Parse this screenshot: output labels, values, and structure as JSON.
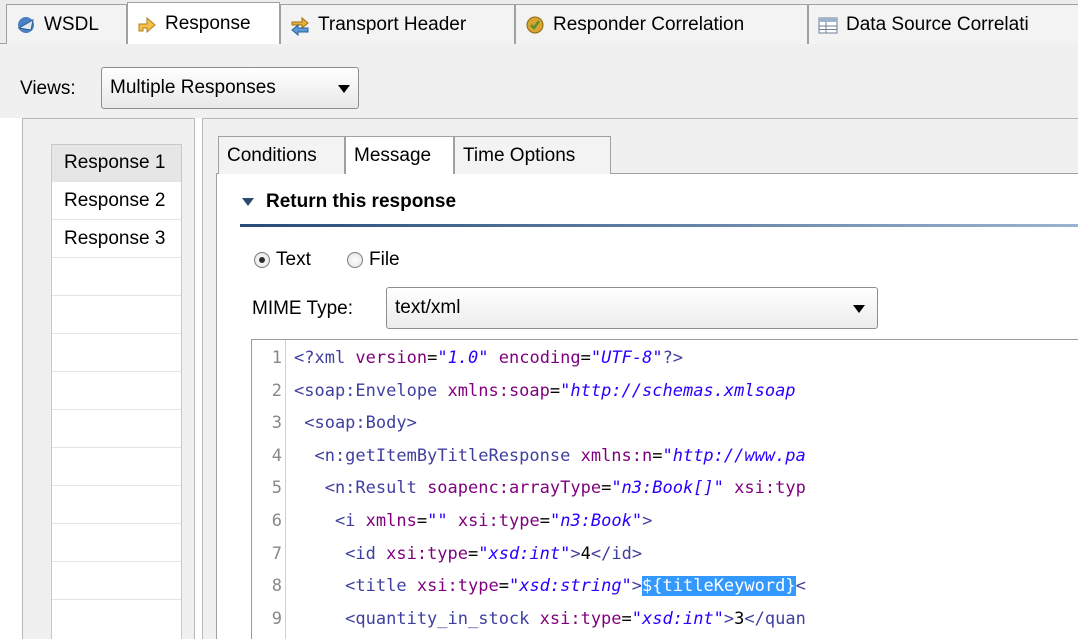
{
  "top_tabs": [
    {
      "label": "WSDL",
      "icon": "wsdl-icon",
      "active": false
    },
    {
      "label": "Response",
      "icon": "response-arrow-icon",
      "active": true
    },
    {
      "label": "Transport Header",
      "icon": "transport-header-icon",
      "active": false
    },
    {
      "label": "Responder Correlation",
      "icon": "responder-correlation-icon",
      "active": false
    },
    {
      "label": "Data Source Correlati",
      "icon": "data-source-table-icon",
      "active": false
    }
  ],
  "views": {
    "label": "Views:",
    "selected": "Multiple Responses"
  },
  "responses": [
    "Response 1",
    "Response 2",
    "Response 3"
  ],
  "inner_tabs": [
    "Conditions",
    "Message",
    "Time Options"
  ],
  "section": {
    "title": "Return this response"
  },
  "radio": {
    "text_label": "Text",
    "file_label": "File",
    "selected": "Text"
  },
  "mime": {
    "label": "MIME Type:",
    "selected": "text/xml"
  },
  "colors": {
    "tag": "#3f3f9f",
    "attr": "#7f007f",
    "value": "#2a00ff",
    "highlight": "#3399ff",
    "section_rule": "#274b78"
  },
  "editor": {
    "lines": [
      {
        "n": "1",
        "parts": [
          [
            "tag",
            "<?xml "
          ],
          [
            "attr",
            "version"
          ],
          [
            "txt",
            "="
          ],
          [
            "val",
            "\"1.0\""
          ],
          [
            "txt",
            " "
          ],
          [
            "attr",
            "encoding"
          ],
          [
            "txt",
            "="
          ],
          [
            "val",
            "\"UTF-8\""
          ],
          [
            "tag",
            "?>"
          ]
        ]
      },
      {
        "n": "2",
        "parts": [
          [
            "tag",
            "<soap:Envelope "
          ],
          [
            "attr",
            "xmlns:soap"
          ],
          [
            "txt",
            "="
          ],
          [
            "val",
            "\"http://schemas.xmlsoap"
          ]
        ]
      },
      {
        "n": "3",
        "parts": [
          [
            "tag",
            " <soap:Body>"
          ]
        ]
      },
      {
        "n": "4",
        "parts": [
          [
            "tag",
            "  <n:getItemByTitleResponse "
          ],
          [
            "attr",
            "xmlns:n"
          ],
          [
            "txt",
            "="
          ],
          [
            "val",
            "\"http://www.pa"
          ]
        ]
      },
      {
        "n": "5",
        "parts": [
          [
            "tag",
            "   <n:Result "
          ],
          [
            "attr",
            "soapenc:arrayType"
          ],
          [
            "txt",
            "="
          ],
          [
            "val",
            "\"n3:Book[]\""
          ],
          [
            "txt",
            " "
          ],
          [
            "attr",
            "xsi:typ"
          ]
        ]
      },
      {
        "n": "6",
        "parts": [
          [
            "tag",
            "    <i "
          ],
          [
            "attr",
            "xmlns"
          ],
          [
            "txt",
            "="
          ],
          [
            "val",
            "\"\""
          ],
          [
            "txt",
            " "
          ],
          [
            "attr",
            "xsi:type"
          ],
          [
            "txt",
            "="
          ],
          [
            "val",
            "\"n3:Book\""
          ],
          [
            "tag",
            ">"
          ]
        ]
      },
      {
        "n": "7",
        "parts": [
          [
            "tag",
            "     <id "
          ],
          [
            "attr",
            "xsi:type"
          ],
          [
            "txt",
            "="
          ],
          [
            "val",
            "\"xsd:int\""
          ],
          [
            "tag",
            ">"
          ],
          [
            "txt",
            "4"
          ],
          [
            "tag",
            "</id>"
          ]
        ]
      },
      {
        "n": "8",
        "parts": [
          [
            "tag",
            "     <title "
          ],
          [
            "attr",
            "xsi:type"
          ],
          [
            "txt",
            "="
          ],
          [
            "val",
            "\"xsd:string\""
          ],
          [
            "tag",
            ">"
          ],
          [
            "hl",
            "${titleKeyword}"
          ],
          [
            "tag",
            "<"
          ]
        ]
      },
      {
        "n": "9",
        "parts": [
          [
            "tag",
            "     <quantity_in_stock "
          ],
          [
            "attr",
            "xsi:type"
          ],
          [
            "txt",
            "="
          ],
          [
            "val",
            "\"xsd:int\""
          ],
          [
            "tag",
            ">"
          ],
          [
            "txt",
            "3"
          ],
          [
            "tag",
            "</quan"
          ]
        ]
      }
    ]
  }
}
